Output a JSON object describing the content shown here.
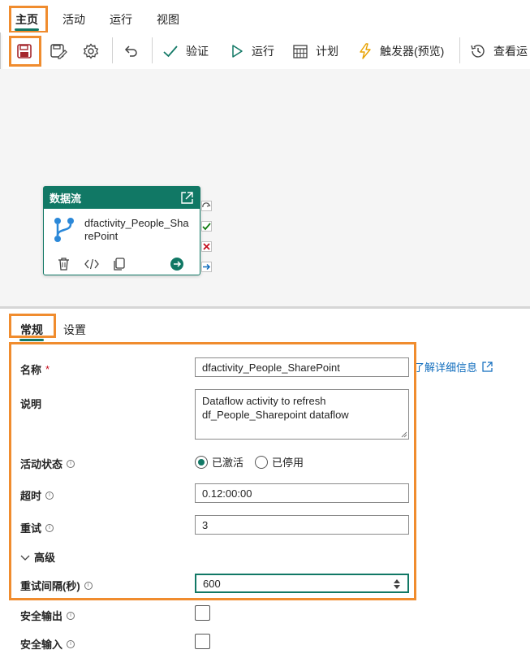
{
  "top_tabs": [
    "主页",
    "活动",
    "运行",
    "视图"
  ],
  "toolbar": {
    "save_icon": "save-icon",
    "validate_label": "验证",
    "run_label": "运行",
    "schedule_label": "计划",
    "trigger_label": "触发器(预览)",
    "view_runs_label": "查看运"
  },
  "activity": {
    "type": "数据流",
    "name": "dfactivity_People_SharePoint"
  },
  "panel": {
    "tabs": [
      "常规",
      "设置"
    ],
    "learn_more": "了解详细信息",
    "name_label": "名称",
    "required_mark": "*",
    "name_value": "dfactivity_People_SharePoint",
    "description_label": "说明",
    "description_value": "Dataflow activity to refresh df_People_Sharepoint dataflow",
    "state_label": "活动状态",
    "state_active": "已激活",
    "state_inactive": "已停用",
    "timeout_label": "超时",
    "timeout_value": "0.12:00:00",
    "retry_label": "重试",
    "retry_value": "3",
    "advanced_label": "高级",
    "retry_interval_label": "重试间隔(秒)",
    "retry_interval_value": "600",
    "secure_output_label": "安全输出",
    "secure_input_label": "安全输入"
  },
  "colors": {
    "accent": "#117865",
    "highlight": "#f08c2e",
    "link": "#0f6cbd"
  }
}
